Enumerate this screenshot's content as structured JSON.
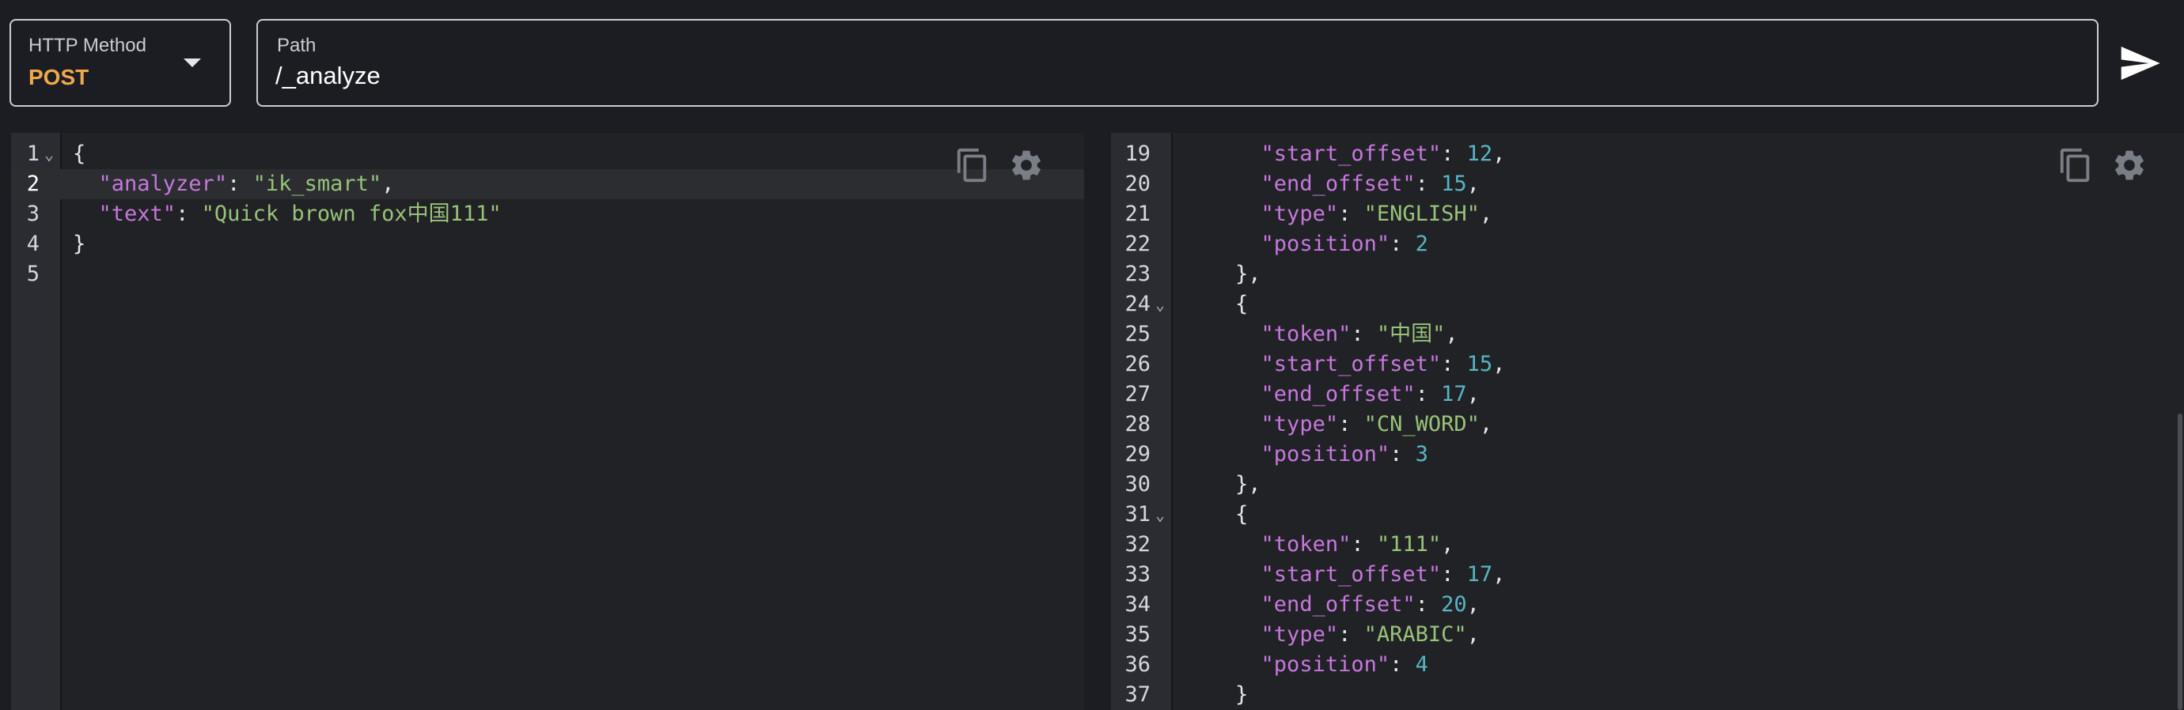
{
  "request": {
    "method_label": "HTTP Method",
    "method_value": "POST",
    "path_label": "Path",
    "path_value": "/_analyze"
  },
  "icons": {
    "dropdown": "chevron-down-icon",
    "send": "send-icon",
    "copy": "copy-icon",
    "settings": "gear-icon"
  },
  "colors": {
    "method_accent": "#f0a84c",
    "json_key": "#c678dd",
    "json_string": "#98c379",
    "json_number": "#56b6c2",
    "background": "#1b1d23",
    "editor_background": "#212226"
  },
  "request_editor": {
    "active_line": 2,
    "lines": [
      {
        "num": "1",
        "fold": true,
        "tokens": [
          [
            "p",
            "{"
          ]
        ]
      },
      {
        "num": "2",
        "fold": false,
        "tokens": [
          [
            "p",
            "  "
          ],
          [
            "k",
            "\"analyzer\""
          ],
          [
            "p",
            ": "
          ],
          [
            "s",
            "\"ik_smart\""
          ],
          [
            "p",
            ","
          ]
        ]
      },
      {
        "num": "3",
        "fold": false,
        "tokens": [
          [
            "p",
            "  "
          ],
          [
            "k",
            "\"text\""
          ],
          [
            "p",
            ": "
          ],
          [
            "s",
            "\"Quick brown fox中国111\""
          ]
        ]
      },
      {
        "num": "4",
        "fold": false,
        "tokens": [
          [
            "p",
            "}"
          ]
        ]
      },
      {
        "num": "5",
        "fold": false,
        "tokens": []
      }
    ]
  },
  "response_editor": {
    "lines": [
      {
        "num": "19",
        "fold": false,
        "tokens": [
          [
            "p",
            "      "
          ],
          [
            "k",
            "\"start_offset\""
          ],
          [
            "p",
            ": "
          ],
          [
            "n",
            "12"
          ],
          [
            "p",
            ","
          ]
        ]
      },
      {
        "num": "20",
        "fold": false,
        "tokens": [
          [
            "p",
            "      "
          ],
          [
            "k",
            "\"end_offset\""
          ],
          [
            "p",
            ": "
          ],
          [
            "n",
            "15"
          ],
          [
            "p",
            ","
          ]
        ]
      },
      {
        "num": "21",
        "fold": false,
        "tokens": [
          [
            "p",
            "      "
          ],
          [
            "k",
            "\"type\""
          ],
          [
            "p",
            ": "
          ],
          [
            "s",
            "\"ENGLISH\""
          ],
          [
            "p",
            ","
          ]
        ]
      },
      {
        "num": "22",
        "fold": false,
        "tokens": [
          [
            "p",
            "      "
          ],
          [
            "k",
            "\"position\""
          ],
          [
            "p",
            ": "
          ],
          [
            "n",
            "2"
          ]
        ]
      },
      {
        "num": "23",
        "fold": false,
        "tokens": [
          [
            "p",
            "    },"
          ]
        ]
      },
      {
        "num": "24",
        "fold": true,
        "tokens": [
          [
            "p",
            "    {"
          ]
        ]
      },
      {
        "num": "25",
        "fold": false,
        "tokens": [
          [
            "p",
            "      "
          ],
          [
            "k",
            "\"token\""
          ],
          [
            "p",
            ": "
          ],
          [
            "s",
            "\"中国\""
          ],
          [
            "p",
            ","
          ]
        ]
      },
      {
        "num": "26",
        "fold": false,
        "tokens": [
          [
            "p",
            "      "
          ],
          [
            "k",
            "\"start_offset\""
          ],
          [
            "p",
            ": "
          ],
          [
            "n",
            "15"
          ],
          [
            "p",
            ","
          ]
        ]
      },
      {
        "num": "27",
        "fold": false,
        "tokens": [
          [
            "p",
            "      "
          ],
          [
            "k",
            "\"end_offset\""
          ],
          [
            "p",
            ": "
          ],
          [
            "n",
            "17"
          ],
          [
            "p",
            ","
          ]
        ]
      },
      {
        "num": "28",
        "fold": false,
        "tokens": [
          [
            "p",
            "      "
          ],
          [
            "k",
            "\"type\""
          ],
          [
            "p",
            ": "
          ],
          [
            "s",
            "\"CN_WORD\""
          ],
          [
            "p",
            ","
          ]
        ]
      },
      {
        "num": "29",
        "fold": false,
        "tokens": [
          [
            "p",
            "      "
          ],
          [
            "k",
            "\"position\""
          ],
          [
            "p",
            ": "
          ],
          [
            "n",
            "3"
          ]
        ]
      },
      {
        "num": "30",
        "fold": false,
        "tokens": [
          [
            "p",
            "    },"
          ]
        ]
      },
      {
        "num": "31",
        "fold": true,
        "tokens": [
          [
            "p",
            "    {"
          ]
        ]
      },
      {
        "num": "32",
        "fold": false,
        "tokens": [
          [
            "p",
            "      "
          ],
          [
            "k",
            "\"token\""
          ],
          [
            "p",
            ": "
          ],
          [
            "s",
            "\"111\""
          ],
          [
            "p",
            ","
          ]
        ]
      },
      {
        "num": "33",
        "fold": false,
        "tokens": [
          [
            "p",
            "      "
          ],
          [
            "k",
            "\"start_offset\""
          ],
          [
            "p",
            ": "
          ],
          [
            "n",
            "17"
          ],
          [
            "p",
            ","
          ]
        ]
      },
      {
        "num": "34",
        "fold": false,
        "tokens": [
          [
            "p",
            "      "
          ],
          [
            "k",
            "\"end_offset\""
          ],
          [
            "p",
            ": "
          ],
          [
            "n",
            "20"
          ],
          [
            "p",
            ","
          ]
        ]
      },
      {
        "num": "35",
        "fold": false,
        "tokens": [
          [
            "p",
            "      "
          ],
          [
            "k",
            "\"type\""
          ],
          [
            "p",
            ": "
          ],
          [
            "s",
            "\"ARABIC\""
          ],
          [
            "p",
            ","
          ]
        ]
      },
      {
        "num": "36",
        "fold": false,
        "tokens": [
          [
            "p",
            "      "
          ],
          [
            "k",
            "\"position\""
          ],
          [
            "p",
            ": "
          ],
          [
            "n",
            "4"
          ]
        ]
      },
      {
        "num": "37",
        "fold": false,
        "tokens": [
          [
            "p",
            "    }"
          ]
        ]
      }
    ]
  }
}
